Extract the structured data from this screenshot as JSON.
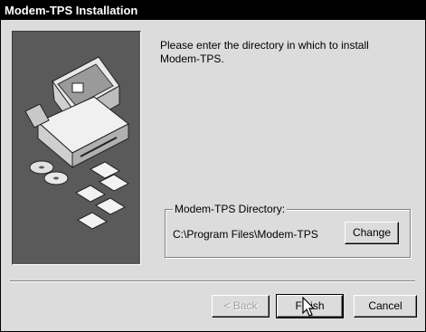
{
  "window": {
    "title": "Modem-TPS Installation"
  },
  "message": "Please enter the directory in which to install Modem-TPS.",
  "directory_group": {
    "label": "Modem-TPS Directory:",
    "path": "C:\\Program Files\\Modem-TPS",
    "change_label": "Change"
  },
  "buttons": {
    "back_label": "< Back",
    "finish_label": "Finish",
    "cancel_label": "Cancel"
  },
  "icons": {
    "art": "computer-with-disks-illustration",
    "cursor": "mouse-pointer-icon"
  }
}
